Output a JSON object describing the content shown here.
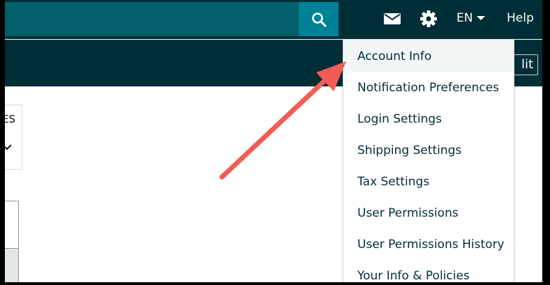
{
  "colors": {
    "nav_dark": "#002e36",
    "search_field": "#005f6b",
    "search_button": "#008296",
    "arrow": "#f25c54",
    "menu_text": "#002e36"
  },
  "icons": {
    "search": "search-icon",
    "mail": "mail-icon",
    "settings": "gear-icon",
    "language_caret": "caret-down-icon"
  },
  "header": {
    "language": "EN",
    "help": "Help"
  },
  "subbar": {
    "edit_partial": "lit"
  },
  "left": {
    "card_text_partial": "ES"
  },
  "settings_menu": {
    "items": [
      {
        "label": "Account Info",
        "highlighted": true
      },
      {
        "label": "Notification Preferences"
      },
      {
        "label": "Login Settings"
      },
      {
        "label": "Shipping Settings"
      },
      {
        "label": "Tax Settings"
      },
      {
        "label": "User Permissions"
      },
      {
        "label": "User Permissions History"
      },
      {
        "label": "Your Info & Policies"
      }
    ]
  }
}
